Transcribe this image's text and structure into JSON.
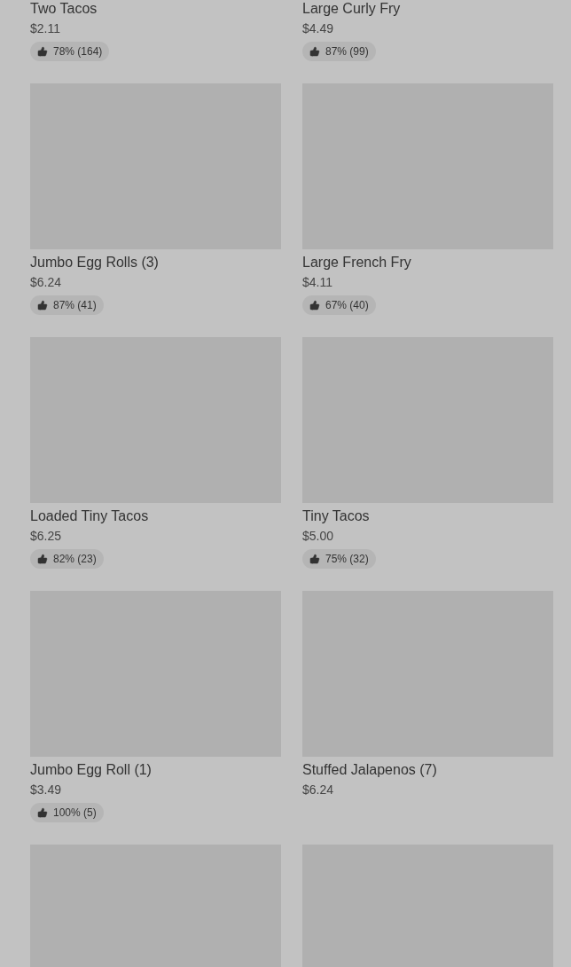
{
  "items": [
    {
      "name": "Two Tacos",
      "price": "$2.11",
      "rating": "78% (164)"
    },
    {
      "name": "Large Curly Fry",
      "price": "$4.49",
      "rating": "87% (99)"
    },
    {
      "image": {
        "kind": "placeholder"
      },
      "name": "Jumbo Egg Rolls (3)",
      "price": "$6.24",
      "rating": "87% (41)"
    },
    {
      "image": {
        "kind": "placeholder"
      },
      "name": "Large French Fry",
      "price": "$4.11",
      "rating": "67% (40)"
    },
    {
      "image": {
        "kind": "placeholder"
      },
      "name": "Loaded Tiny Tacos",
      "price": "$6.25",
      "rating": "82% (23)"
    },
    {
      "image": {
        "kind": "placeholder"
      },
      "name": "Tiny Tacos",
      "price": "$5.00",
      "rating": "75% (32)"
    },
    {
      "image": {
        "kind": "placeholder"
      },
      "name": "Jumbo Egg Roll (1)",
      "price": "$3.49",
      "rating": "100% (5)"
    },
    {
      "image": {
        "kind": "placeholder"
      },
      "name": "Stuffed Jalapenos (7)",
      "price": "$6.24"
    },
    {
      "image": {
        "kind": "placeholder"
      }
    },
    {
      "image": {
        "kind": "placeholder"
      }
    }
  ]
}
